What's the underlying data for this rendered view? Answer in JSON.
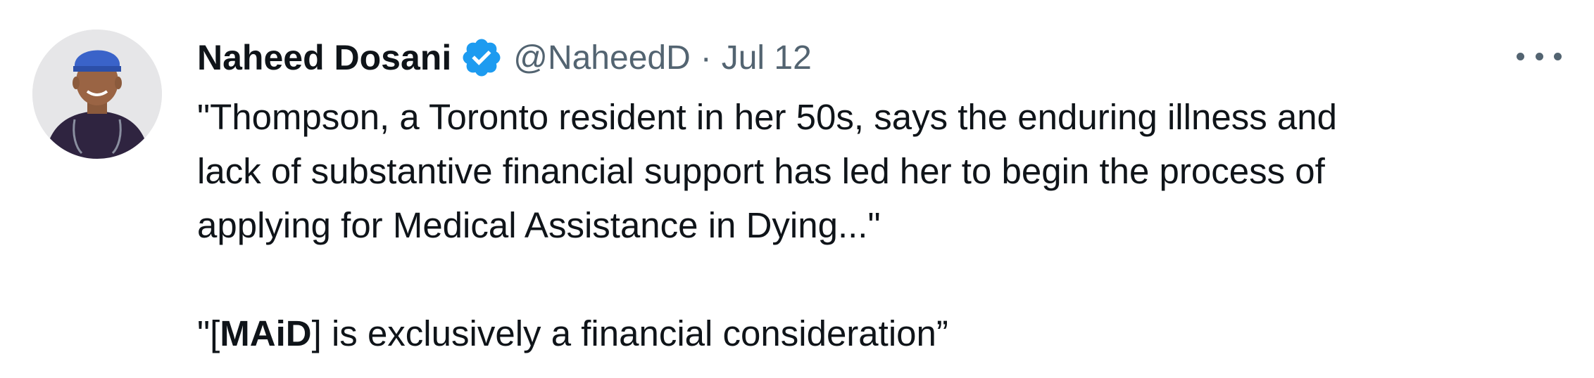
{
  "tweet": {
    "author_name": "Naheed Dosani",
    "handle": "@NaheedD",
    "separator": "·",
    "date": "Jul 12",
    "verified_icon": "verified-badge-icon",
    "more_icon": "more-options-icon",
    "accent_color": "#1d9bf0",
    "text_lines": [
      "\"Thompson, a Toronto resident in her 50s, says the enduring illness and",
      "lack of substantive financial support has led her to begin the process of",
      "applying for Medical Assistance in Dying...\""
    ],
    "quote": {
      "prefix": "\"[",
      "bold": "MAiD",
      "suffix": "] is exclusively a financial consideration”"
    }
  }
}
